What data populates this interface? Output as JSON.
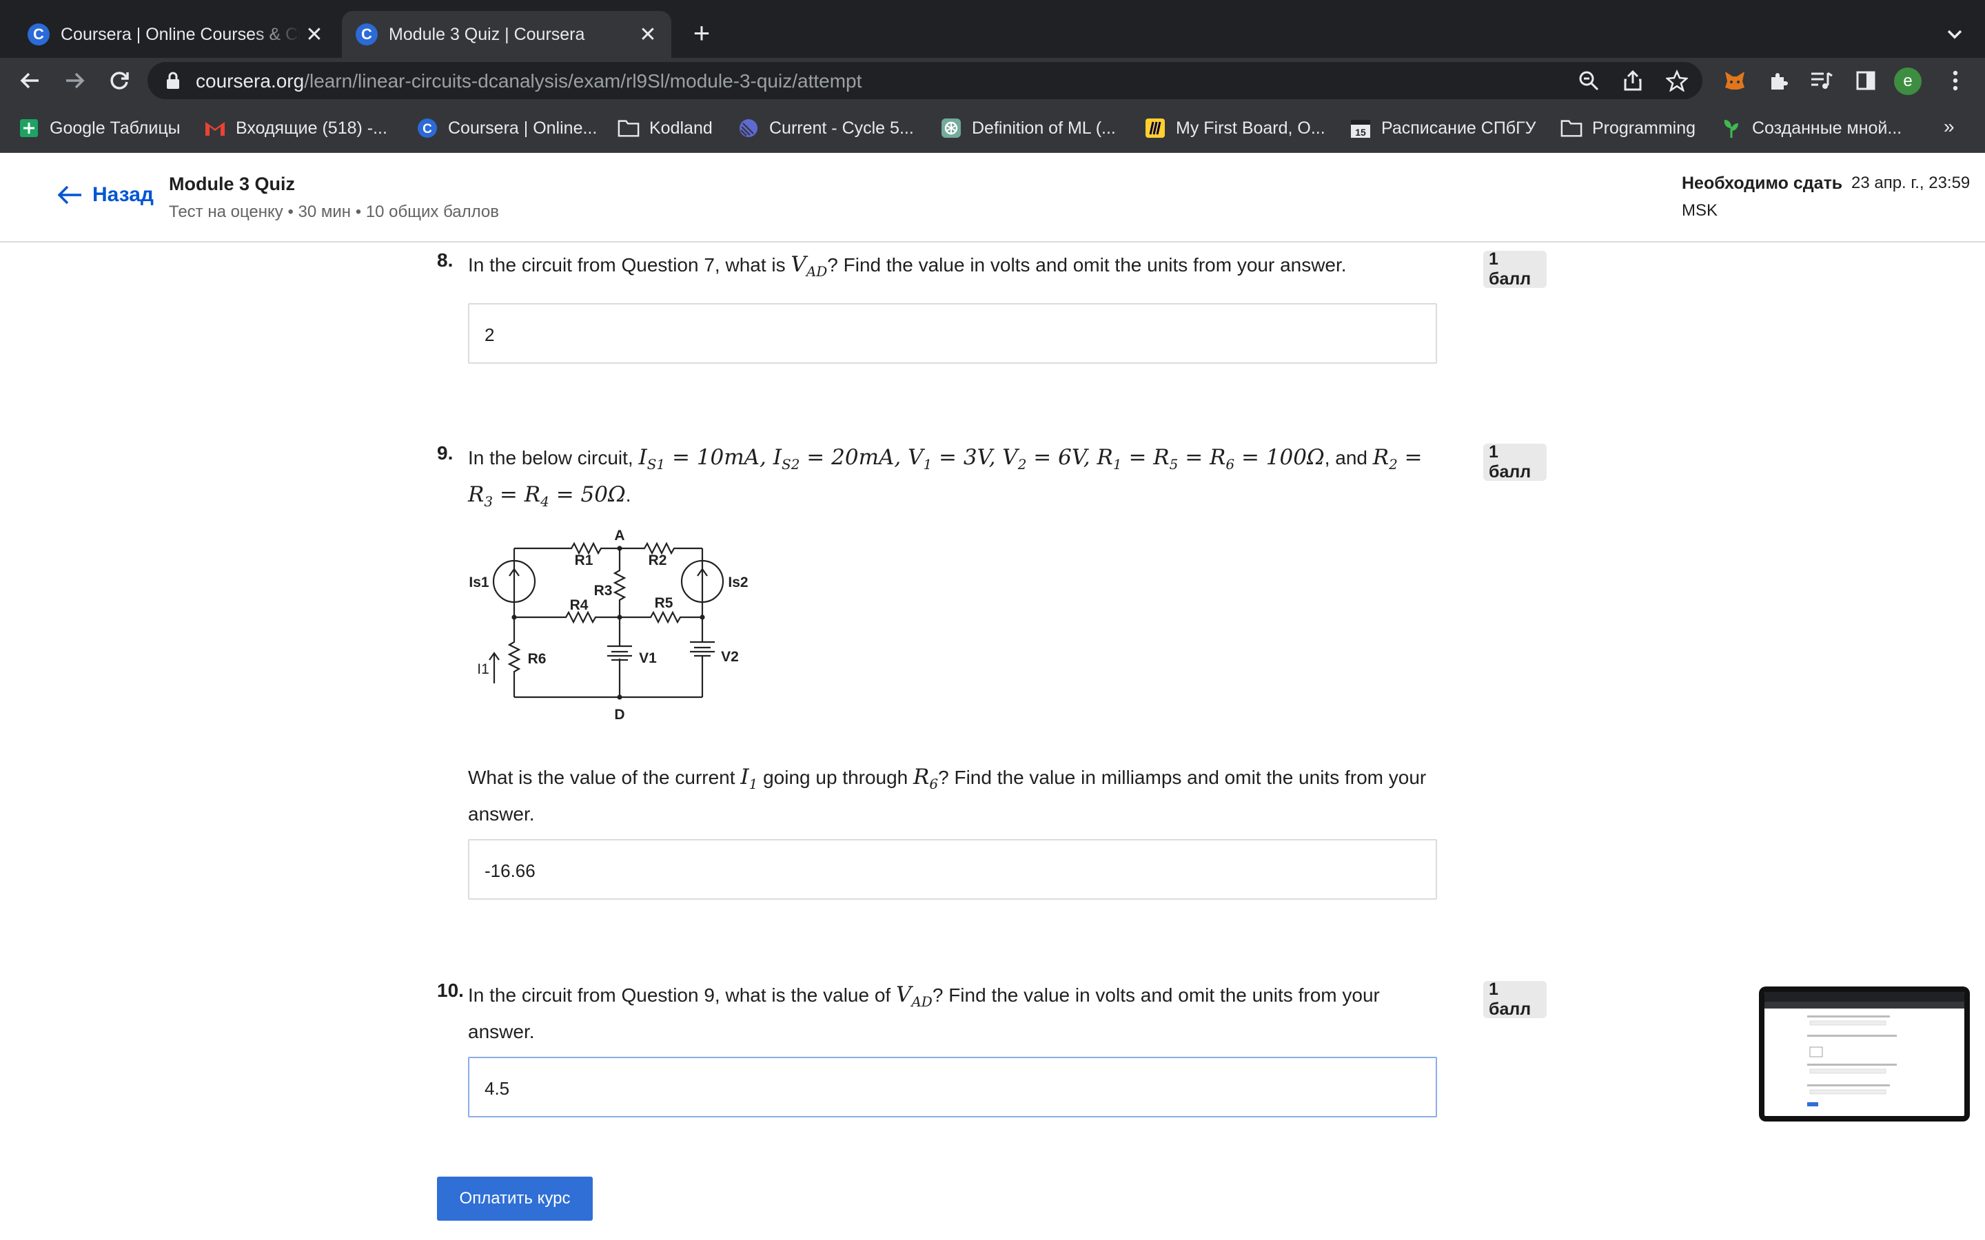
{
  "browser": {
    "tabs": [
      {
        "title": "Coursera | Online Courses & Credentials",
        "favicon": "C",
        "active": false
      },
      {
        "title": "Module 3 Quiz | Coursera",
        "favicon": "C",
        "active": true
      }
    ],
    "url_host": "coursera.org",
    "url_path": "/learn/linear-circuits-dcanalysis/exam/rl9Sl/module-3-quiz/attempt",
    "avatar_letter": "e",
    "bookmarks": [
      {
        "label": "Google Таблицы",
        "icon": "sheets-icon"
      },
      {
        "label": "Входящие (518) -...",
        "icon": "gmail-icon"
      },
      {
        "label": "Coursera | Online...",
        "icon": "coursera-icon"
      },
      {
        "label": "Kodland",
        "icon": "folder-icon"
      },
      {
        "label": "Current - Cycle 5...",
        "icon": "linear-icon"
      },
      {
        "label": "Definition of ML (...",
        "icon": "openai-icon"
      },
      {
        "label": "My First Board, O...",
        "icon": "miro-icon"
      },
      {
        "label": "Расписание СПбГУ",
        "icon": "calendar-icon"
      },
      {
        "label": "Programming",
        "icon": "folder-icon"
      },
      {
        "label": "Созданные мной...",
        "icon": "sprout-icon"
      }
    ],
    "bookmarks_more": "»"
  },
  "header": {
    "back_label": "Назад",
    "quiz_title": "Module 3 Quiz",
    "quiz_subtitle": "Тест на оценку • 30 мин • 10 общих баллов",
    "due_label": "Необходимо сдать",
    "due_date": "23 апр. г., 23:59",
    "due_tz": "MSK"
  },
  "questions": [
    {
      "number": "8.",
      "points": "1 балл",
      "answer": "2"
    },
    {
      "number": "9.",
      "points": "1 балл",
      "answer": "-16.66"
    },
    {
      "number": "10.",
      "points": "1 балл",
      "answer": "4.5"
    }
  ],
  "circuit_labels": {
    "A": "A",
    "D": "D",
    "R1": "R1",
    "R2": "R2",
    "R3": "R3",
    "R4": "R4",
    "R5": "R5",
    "R6": "R6",
    "Is1": "Is1",
    "Is2": "Is2",
    "V1": "V1",
    "V2": "V2",
    "I1": "I1"
  },
  "pay_button": "Оплатить курс"
}
